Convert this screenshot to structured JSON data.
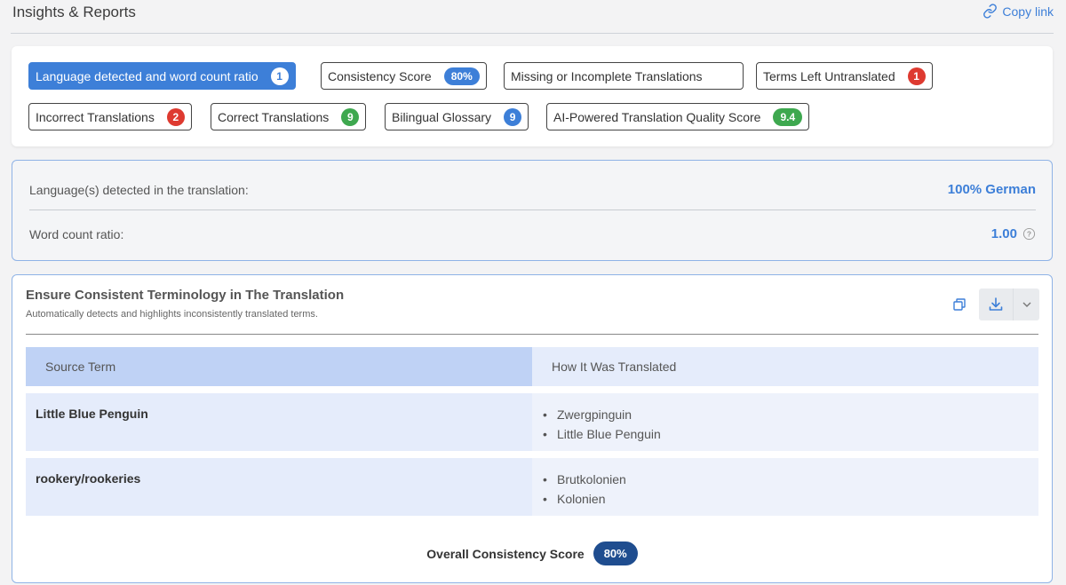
{
  "header": {
    "title": "Insights & Reports",
    "copy_link": "Copy link"
  },
  "tags": [
    {
      "label": "Language detected and word count ratio",
      "badge": "1",
      "badge_color": "white",
      "active": true
    },
    {
      "label": "Consistency Score",
      "badge": "80%",
      "badge_color": "blue",
      "active": false
    },
    {
      "label": "Missing or Incomplete Translations",
      "badge": "",
      "badge_color": "",
      "active": false
    },
    {
      "label": "Terms Left Untranslated",
      "badge": "1",
      "badge_color": "red",
      "active": false
    },
    {
      "label": "Incorrect Translations",
      "badge": "2",
      "badge_color": "red",
      "active": false
    },
    {
      "label": "Correct Translations",
      "badge": "9",
      "badge_color": "green",
      "active": false
    },
    {
      "label": "Bilingual Glossary",
      "badge": "9",
      "badge_color": "blue",
      "active": false
    },
    {
      "label": "AI-Powered Translation Quality Score",
      "badge": "9.4",
      "badge_color": "green",
      "active": false
    }
  ],
  "language": {
    "detected_label": "Language(s) detected in the translation:",
    "detected_value": "100% German",
    "ratio_label": "Word count ratio:",
    "ratio_value": "1.00"
  },
  "consistency": {
    "title": "Ensure Consistent Terminology in The Translation",
    "subtitle": "Automatically detects and highlights inconsistently translated terms.",
    "columns": [
      "Source Term",
      "How It Was Translated"
    ],
    "rows": [
      {
        "source": "Little Blue Penguin",
        "translations": [
          "Zwergpinguin",
          "Little Blue Penguin"
        ]
      },
      {
        "source": "rookery/rookeries",
        "translations": [
          "Brutkolonien",
          "Kolonien"
        ]
      }
    ],
    "overall_label": "Overall Consistency Score",
    "overall_value": "80%"
  },
  "colors": {
    "accent": "#3d7fd8",
    "red": "#de3a30",
    "green": "#3ea84f",
    "dark_badge": "#1f4d8f"
  }
}
